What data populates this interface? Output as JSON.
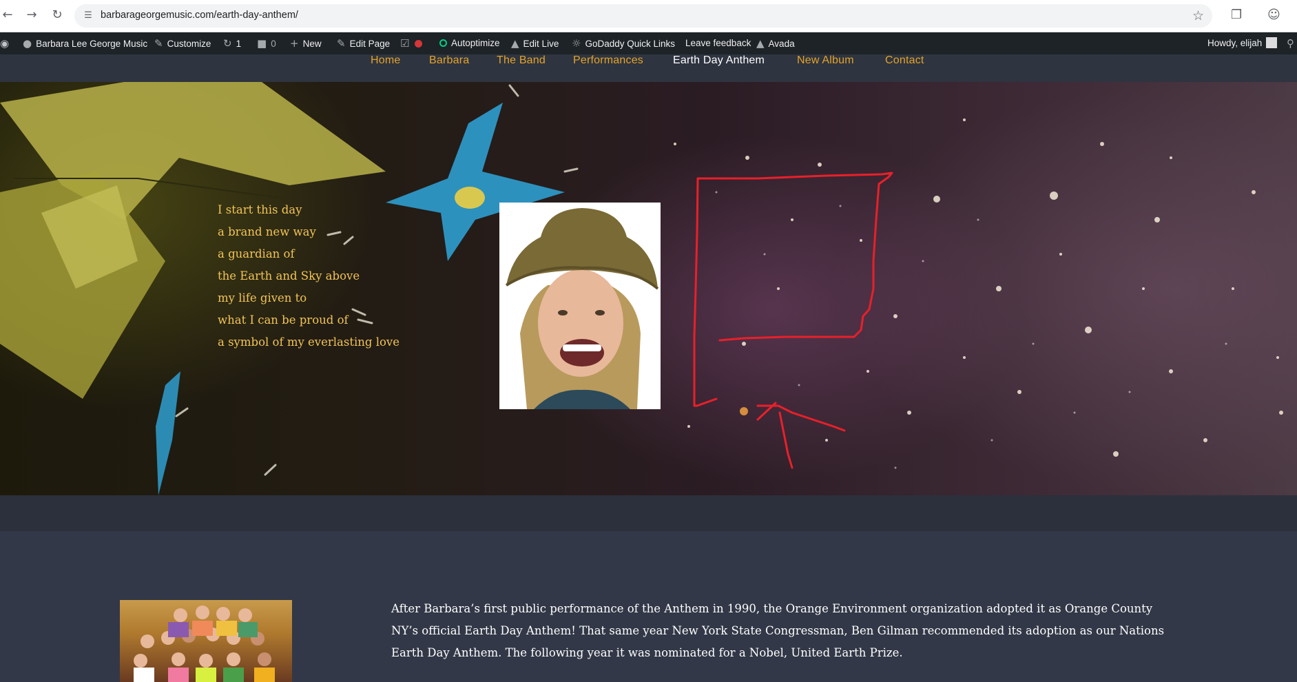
{
  "browser": {
    "url": "barbarageorgemusic.com/earth-day-anthem/"
  },
  "adminbar": {
    "site_name": "Barbara Lee George Music",
    "customize": "Customize",
    "updates_count": "1",
    "comments_count": "0",
    "new": "New",
    "edit_page": "Edit Page",
    "autoptimize": "Autoptimize",
    "edit_live": "Edit Live",
    "godaddy": "GoDaddy Quick Links",
    "feedback": "Leave feedback",
    "avada": "Avada",
    "howdy": "Howdy, elijah"
  },
  "menu": [
    {
      "label": "Home"
    },
    {
      "label": "Barbara"
    },
    {
      "label": "The Band"
    },
    {
      "label": "Performances"
    },
    {
      "label": "Earth Day Anthem"
    },
    {
      "label": "New Album"
    },
    {
      "label": "Contact"
    }
  ],
  "lyrics": [
    "I start this day",
    "a brand new way",
    "a guardian of",
    "the Earth and Sky above",
    "my life given to",
    "what I can be proud of",
    "a symbol of my everlasting love"
  ],
  "content": {
    "paragraph": "After Barbara’s first public performance of the Anthem in 1990, the Orange Environment organization adopted it as Orange County NY’s official Earth Day Anthem! That same year New York State Congressman, Ben Gilman recommended its adoption as our Nations Earth Day Anthem. The following year it was nominated for a Nobel, United Earth Prize."
  },
  "colors": {
    "menu_link": "#e4a329",
    "menu_current": "#ffffff",
    "lyrics_text": "#f2c457",
    "annotation": "#e8202a"
  }
}
